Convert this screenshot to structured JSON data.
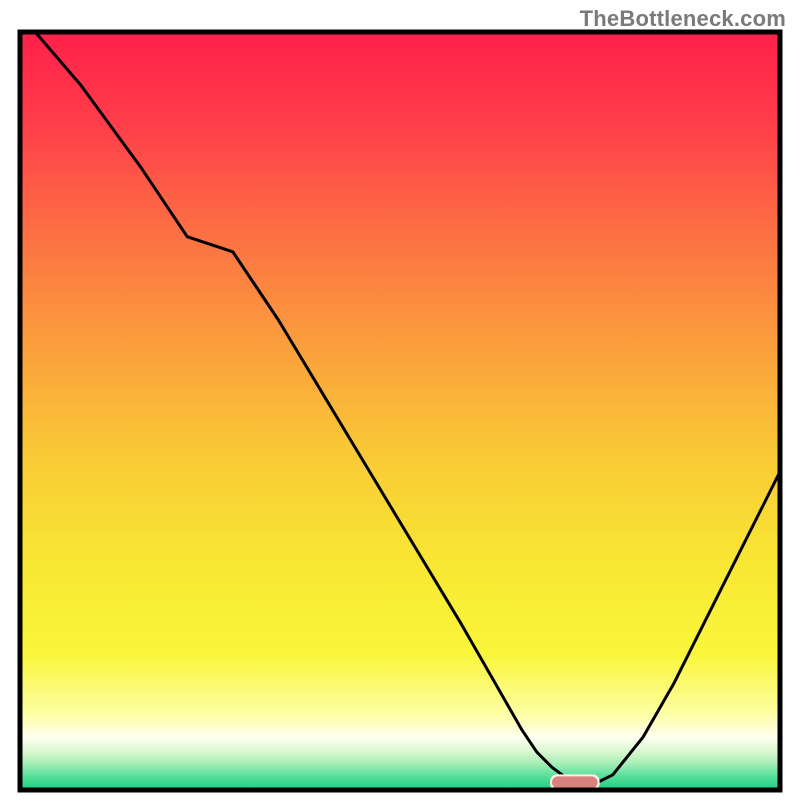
{
  "watermark": "TheBottleneck.com",
  "colors": {
    "frame": "#000000",
    "line": "#000000",
    "marker_fill": "#d9817e",
    "marker_shadow": "#fff1e8",
    "gradient_stops": [
      {
        "offset": 0.0,
        "color": "#ff204a"
      },
      {
        "offset": 0.12,
        "color": "#ff3d4a"
      },
      {
        "offset": 0.25,
        "color": "#fd6b44"
      },
      {
        "offset": 0.4,
        "color": "#fb9a3d"
      },
      {
        "offset": 0.55,
        "color": "#f9c836"
      },
      {
        "offset": 0.7,
        "color": "#f8e733"
      },
      {
        "offset": 0.82,
        "color": "#faf63a"
      },
      {
        "offset": 0.9,
        "color": "#fdfea4"
      },
      {
        "offset": 0.93,
        "color": "#fffff0"
      },
      {
        "offset": 0.95,
        "color": "#d7f7cf"
      },
      {
        "offset": 0.965,
        "color": "#a7eeb7"
      },
      {
        "offset": 0.98,
        "color": "#5fe09c"
      },
      {
        "offset": 1.0,
        "color": "#17d181"
      }
    ]
  },
  "chart_data": {
    "type": "line",
    "title": "",
    "xlabel": "",
    "ylabel": "",
    "xlim": [
      0,
      100
    ],
    "ylim": [
      0,
      100
    ],
    "grid": false,
    "annotations": [],
    "series": [
      {
        "name": "curve",
        "x": [
          2,
          8,
          16,
          22,
          28,
          34,
          40,
          46,
          52,
          58,
          62,
          66,
          68,
          70,
          72,
          74,
          76,
          78,
          82,
          86,
          90,
          94,
          98,
          100
        ],
        "y": [
          100,
          93,
          82,
          73,
          71,
          62,
          52,
          42,
          32,
          22,
          15,
          8,
          5,
          3,
          1.5,
          1,
          1,
          2,
          7,
          14,
          22,
          30,
          38,
          42
        ]
      }
    ],
    "marker": {
      "x_start": 70,
      "x_end": 76,
      "y": 1
    }
  }
}
